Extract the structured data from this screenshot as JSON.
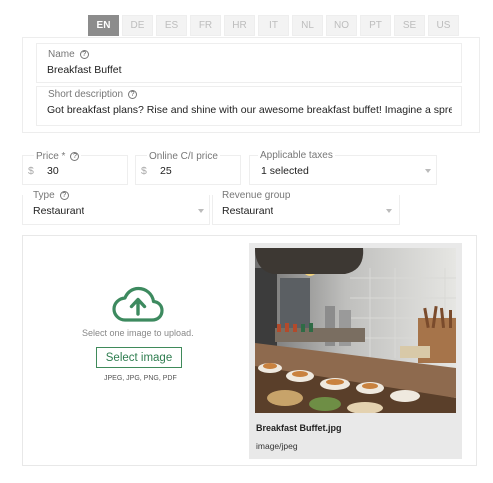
{
  "languages": [
    "EN",
    "DE",
    "ES",
    "FR",
    "HR",
    "IT",
    "NL",
    "NO",
    "PT",
    "SE",
    "US"
  ],
  "active_language": "EN",
  "name_field": {
    "label": "Name",
    "value": "Breakfast Buffet"
  },
  "short_description": {
    "label": "Short description",
    "value": "Got breakfast plans? Rise and shine with our awesome breakfast buffet! Imagine a spread of m"
  },
  "price": {
    "label": "Price *",
    "currency": "$",
    "value": "30"
  },
  "online_price": {
    "label": "Online C/I price",
    "currency": "$",
    "value": "25"
  },
  "taxes": {
    "label": "Applicable taxes",
    "value": "1 selected"
  },
  "type": {
    "label": "Type",
    "value": "Restaurant"
  },
  "revenue_group": {
    "label": "Revenue group",
    "value": "Restaurant"
  },
  "upload": {
    "prompt": "Select one image to upload.",
    "button_label": "Select image",
    "formats": "JPEG, JPG, PNG, PDF"
  },
  "preview": {
    "file_name": "Breakfast Buffet.jpg",
    "mime": "image/jpeg"
  },
  "colors": {
    "accent": "#2e7d4f",
    "cloud": "#3d8a5f",
    "tab_active": "#8c8c8c"
  }
}
